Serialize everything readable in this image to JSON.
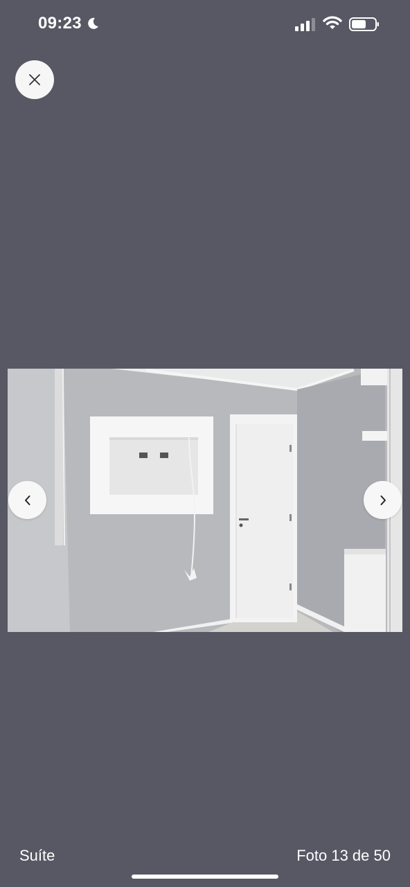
{
  "status_bar": {
    "time": "09:23",
    "icons": [
      "moon-icon",
      "signal-icon",
      "wifi-icon",
      "battery-icon"
    ]
  },
  "viewer": {
    "close_icon": "close-icon",
    "prev_icon": "chevron-left-icon",
    "next_icon": "chevron-right-icon",
    "background_color": "#575864",
    "photo": {
      "subject": "room"
    }
  },
  "footer": {
    "caption": "Suíte",
    "counter": "Foto 13 de 50"
  }
}
